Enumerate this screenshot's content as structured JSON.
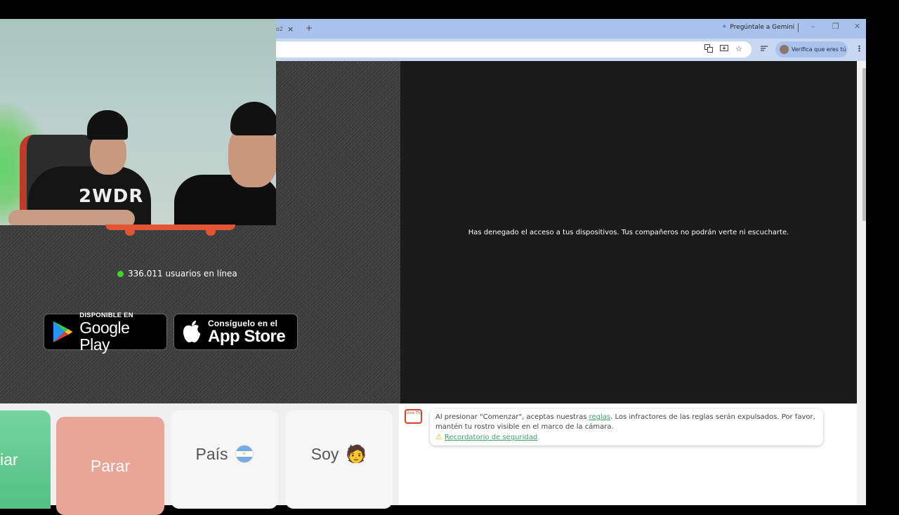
{
  "left_panel": {
    "webcam_shirt_text": "2WDR",
    "online_count": "336.011 usuarios en línea",
    "google_play": {
      "small": "DISPONIBLE EN",
      "big": "Google Play"
    },
    "app_store": {
      "small": "Consíguelo en el",
      "big": "App Store"
    }
  },
  "browser": {
    "tab_fragment": "o2",
    "tab_close": "×",
    "new_tab": "+",
    "gemini_label": "Pregúntale a Gemini",
    "window_controls": [
      "–",
      "❐",
      "✕"
    ],
    "verify_label": "Verifica que eres tú",
    "toolbar_icons": [
      "translate-icon",
      "install-icon",
      "star-icon",
      "reading-list-icon"
    ],
    "menu": "⋮"
  },
  "video": {
    "denied_message": "Has denegado el acceso a tus dispositivos. Tus compañeros no podrán verte ni escucharte."
  },
  "controls": {
    "start_label": "iar",
    "stop_label": "Parar",
    "country_label": "País",
    "me_label": "Soy",
    "me_emoji": "🧑"
  },
  "chat": {
    "logo_text": "Ome TV",
    "msg_prefix": "Al presionar \"Comenzar\", aceptas nuestras ",
    "msg_link": "reglas",
    "msg_suffix": ". Los infractores de las reglas serán expulsados. Por favor, mantén tu rostro visible en el marco de la cámara.",
    "safety_link": "Recordatorio de seguridad"
  },
  "colors": {
    "online_dot": "#3ed625",
    "start_green": "#53c184",
    "stop_salmon": "#e9a595",
    "chrome_tab": "#a9c2ec"
  }
}
